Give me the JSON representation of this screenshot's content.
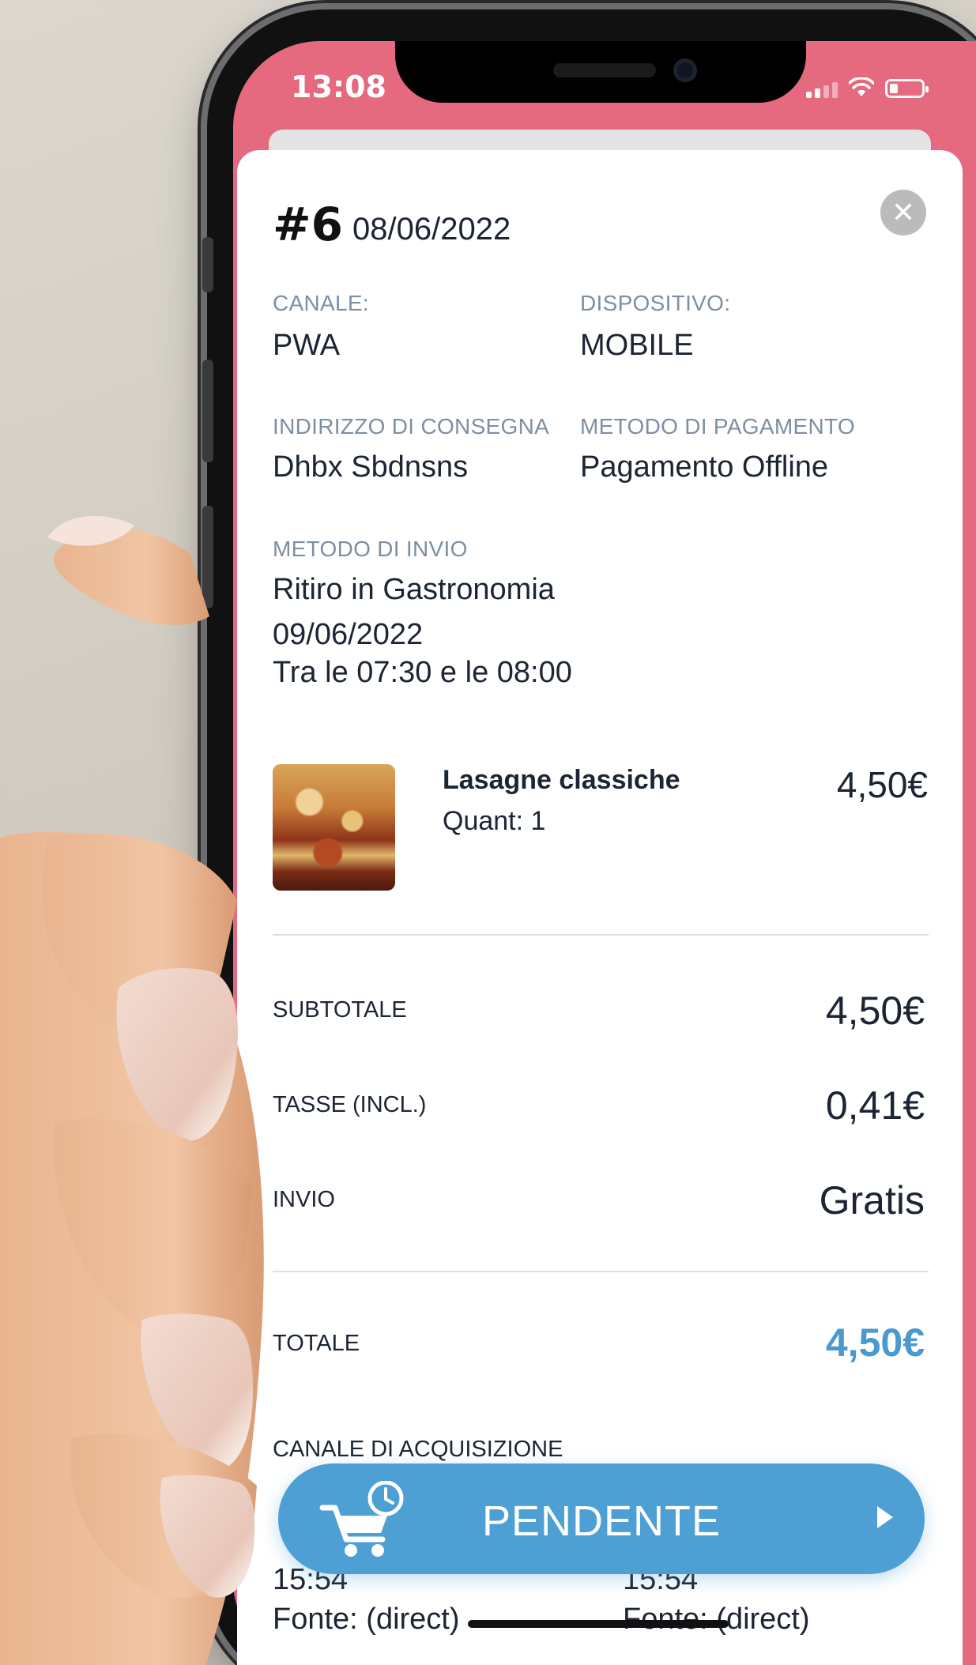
{
  "status_bar": {
    "time": "13:08"
  },
  "order": {
    "number": "#6",
    "date": "08/06/2022"
  },
  "details": {
    "canale_label": "CANALE:",
    "canale_value": "PWA",
    "dispositivo_label": "DISPOSITIVO:",
    "dispositivo_value": "MOBILE",
    "indirizzo_label": "INDIRIZZO DI CONSEGNA",
    "indirizzo_value": "Dhbx Sbdnsns",
    "pagamento_label": "METODO DI PAGAMENTO",
    "pagamento_value": "Pagamento Offline",
    "invio_label": "METODO DI INVIO",
    "invio_value": "Ritiro in Gastronomia",
    "invio_date": "09/06/2022",
    "invio_time": "Tra le 07:30 e le 08:00"
  },
  "item": {
    "name": "Lasagne classiche",
    "qty": "Quant: 1",
    "price": "4,50€"
  },
  "summary": {
    "subtotale_label": "SUBTOTALE",
    "subtotale_value": "4,50€",
    "tasse_label": "TASSE (INCL.)",
    "tasse_value": "0,41€",
    "invio_label": "INVIO",
    "invio_value": "Gratis",
    "totale_label": "TOTALE",
    "totale_value": "4,50€"
  },
  "acquisition": {
    "title": "CANALE DI ACQUISIZIONE",
    "left_time": "15:54",
    "left_source": "Fonte: (direct)",
    "right_time": "15:54",
    "right_source": "Fonte: (direct)"
  },
  "status_button": {
    "label": "PENDENTE"
  },
  "colors": {
    "header": "#e56a7f",
    "accent": "#4e9fd4",
    "text": "#1c2533",
    "label": "#7d8fa3"
  }
}
